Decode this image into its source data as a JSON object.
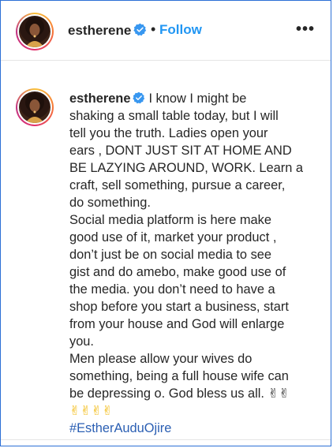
{
  "header": {
    "username": "estherene",
    "separator": "•",
    "follow_label": "Follow",
    "more_label": "•••"
  },
  "post": {
    "username": "estherene",
    "lines": [
      "I know I might be",
      "shaking a small table today, but I will",
      "tell you the truth. Ladies open your",
      "ears , DONT JUST SIT AT HOME AND",
      "BE LAZYING AROUND, WORK. Learn a",
      "craft, sell something, pursue a career,",
      "do something.",
      "Social media platform is here make",
      "good use of it, market your product ,",
      "don’t just be on social media to see",
      "gist and do amebo, make good use of",
      "the media. you don’t need to have a",
      "shop before you start a business, start",
      "from your house and God will enlarge",
      "you.",
      "Men please allow your wives do",
      "something, being a full house wife can",
      "be depressing o. God bless us all. ✌✌",
      "✌✌✌✌"
    ],
    "hashtag": "#EstherAuduOjire"
  },
  "colors": {
    "follow": "#2196f3",
    "verified": "#3897f0",
    "hashtag": "#2b5fb3",
    "text": "#262626"
  },
  "icons": {
    "verified": "verified-badge-icon",
    "more": "more-options-icon",
    "victory_hand": "victory-hand-emoji"
  }
}
